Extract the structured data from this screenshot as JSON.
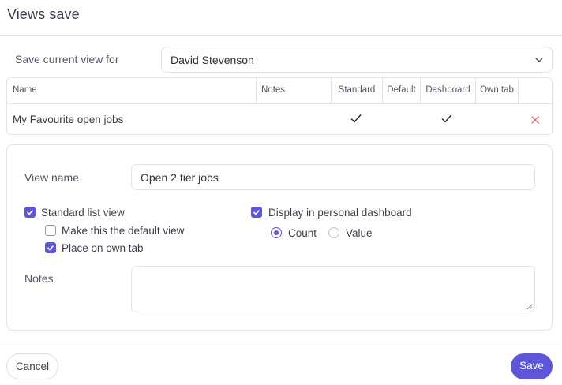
{
  "dialog": {
    "title": "Views save"
  },
  "save_for": {
    "label": "Save current view for",
    "selected": "David Stevenson"
  },
  "table": {
    "columns": [
      "Name",
      "Notes",
      "Standard",
      "Default",
      "Dashboard",
      "Own tab"
    ],
    "rows": [
      {
        "name": "My Favourite open jobs",
        "notes": "",
        "standard": true,
        "default": false,
        "dashboard": true,
        "own_tab": false
      }
    ]
  },
  "form": {
    "view_name_label": "View name",
    "view_name_value": "Open 2 tier jobs",
    "standard_list_view": {
      "label": "Standard list view",
      "checked": true
    },
    "make_default": {
      "label": "Make this the default view",
      "checked": false
    },
    "own_tab": {
      "label": "Place on own tab",
      "checked": true
    },
    "display_dashboard": {
      "label": "Display in personal dashboard",
      "checked": true
    },
    "dashboard_mode": {
      "options": [
        "Count",
        "Value"
      ],
      "selected": "Count"
    },
    "notes_label": "Notes",
    "notes_value": ""
  },
  "footer": {
    "cancel_label": "Cancel",
    "save_label": "Save"
  },
  "colors": {
    "accent": "#5f55d8",
    "delete": "#e05a5a",
    "border": "#e2e2e8"
  },
  "icons": {
    "select_chevron": "chevron-down-icon",
    "row_check": "check-icon",
    "row_delete": "close-icon",
    "checkbox_mark": "check-icon"
  }
}
